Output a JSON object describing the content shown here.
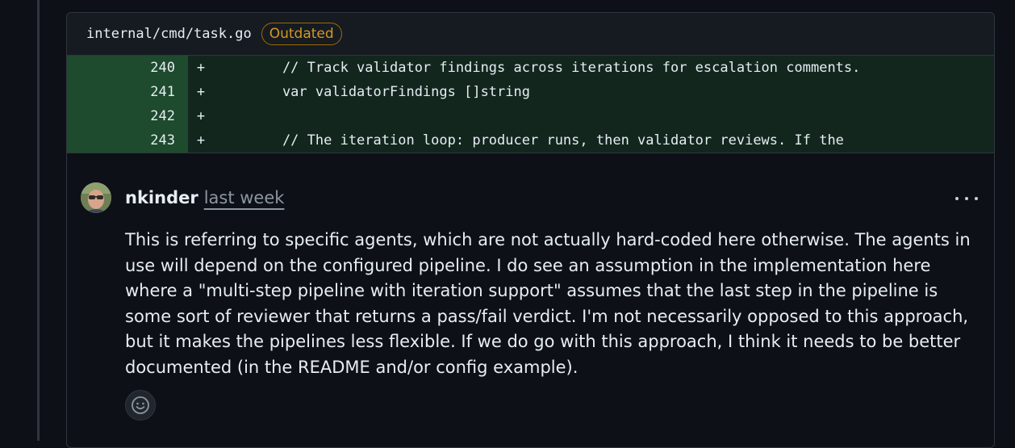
{
  "file": {
    "path": "internal/cmd/task.go",
    "badge": "Outdated"
  },
  "diff": {
    "lines": [
      {
        "num": "240",
        "sign": "+",
        "code": "    // Track validator findings across iterations for escalation comments."
      },
      {
        "num": "241",
        "sign": "+",
        "code": "    var validatorFindings []string"
      },
      {
        "num": "242",
        "sign": "+",
        "code": ""
      },
      {
        "num": "243",
        "sign": "+",
        "code": "    // The iteration loop: producer runs, then validator reviews. If the"
      }
    ]
  },
  "comment": {
    "author": "nkinder",
    "time": "last week",
    "body": "This is referring to specific agents, which are not actually hard-coded here otherwise. The agents in use will depend on the configured pipeline. I do see an assumption in the implementation here where a \"multi-step pipeline with iteration support\" assumes that the last step in the pipeline is some sort of reviewer that returns a pass/fail verdict. I'm not necessarily opposed to this approach, but it makes the pipelines less flexible. If we do go with this approach, I think it needs to be better documented (in the README and/or config example).",
    "avatar_icon": "user-avatar",
    "menu_icon": "kebab-horizontal-icon",
    "reaction_icon": "smiley-icon"
  },
  "colors": {
    "background": "#0d1117",
    "diff_add_bg": "#12261e",
    "diff_add_num_bg": "#1e4a2d",
    "badge": "#d29922",
    "muted": "#8d96a0"
  }
}
